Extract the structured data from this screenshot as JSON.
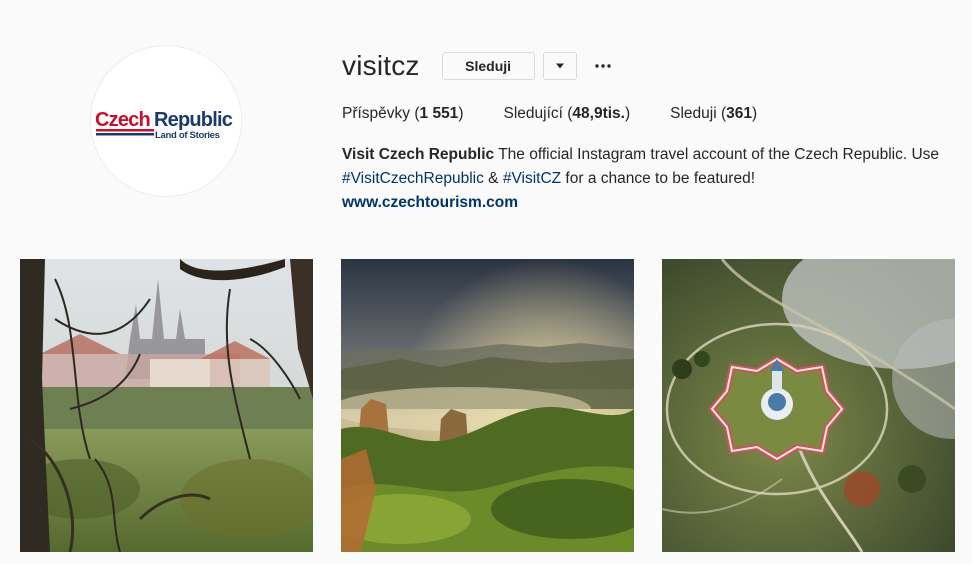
{
  "profile": {
    "username": "visitcz",
    "follow_label": "Sleduji",
    "logo": {
      "word_czech": "Czech",
      "word_republic": "Republic",
      "tagline": "Land of Stories",
      "brand_red": "#c8102e",
      "brand_blue": "#1b3a6b"
    }
  },
  "stats": {
    "posts_label": "Příspěvky (",
    "posts_count": "1 551",
    "posts_close": ")",
    "followers_label": "Sledující (",
    "followers_count": "48,9tis.",
    "followers_close": ")",
    "following_label": "Sleduji (",
    "following_count": "361",
    "following_close": ")"
  },
  "bio": {
    "name": "Visit Czech Republic",
    "text_1": " The official Instagram travel account of the Czech Republic. Use ",
    "hashtag_1": "#VisitCzechRepublic",
    "text_2": " & ",
    "hashtag_2": "#VisitCZ",
    "text_3": " for a chance to be featured!",
    "website": "www.czechtourism.com"
  },
  "posts": [
    {
      "icon": "photo-prague-castle-misty-park"
    },
    {
      "icon": "photo-bohemian-switzerland-sandstone-sunrise"
    },
    {
      "icon": "photo-zelena-hora-star-church-aerial"
    }
  ],
  "colors": {
    "background": "#fafafa",
    "text": "#262626",
    "link": "#003569",
    "border": "#dbdbdb"
  }
}
